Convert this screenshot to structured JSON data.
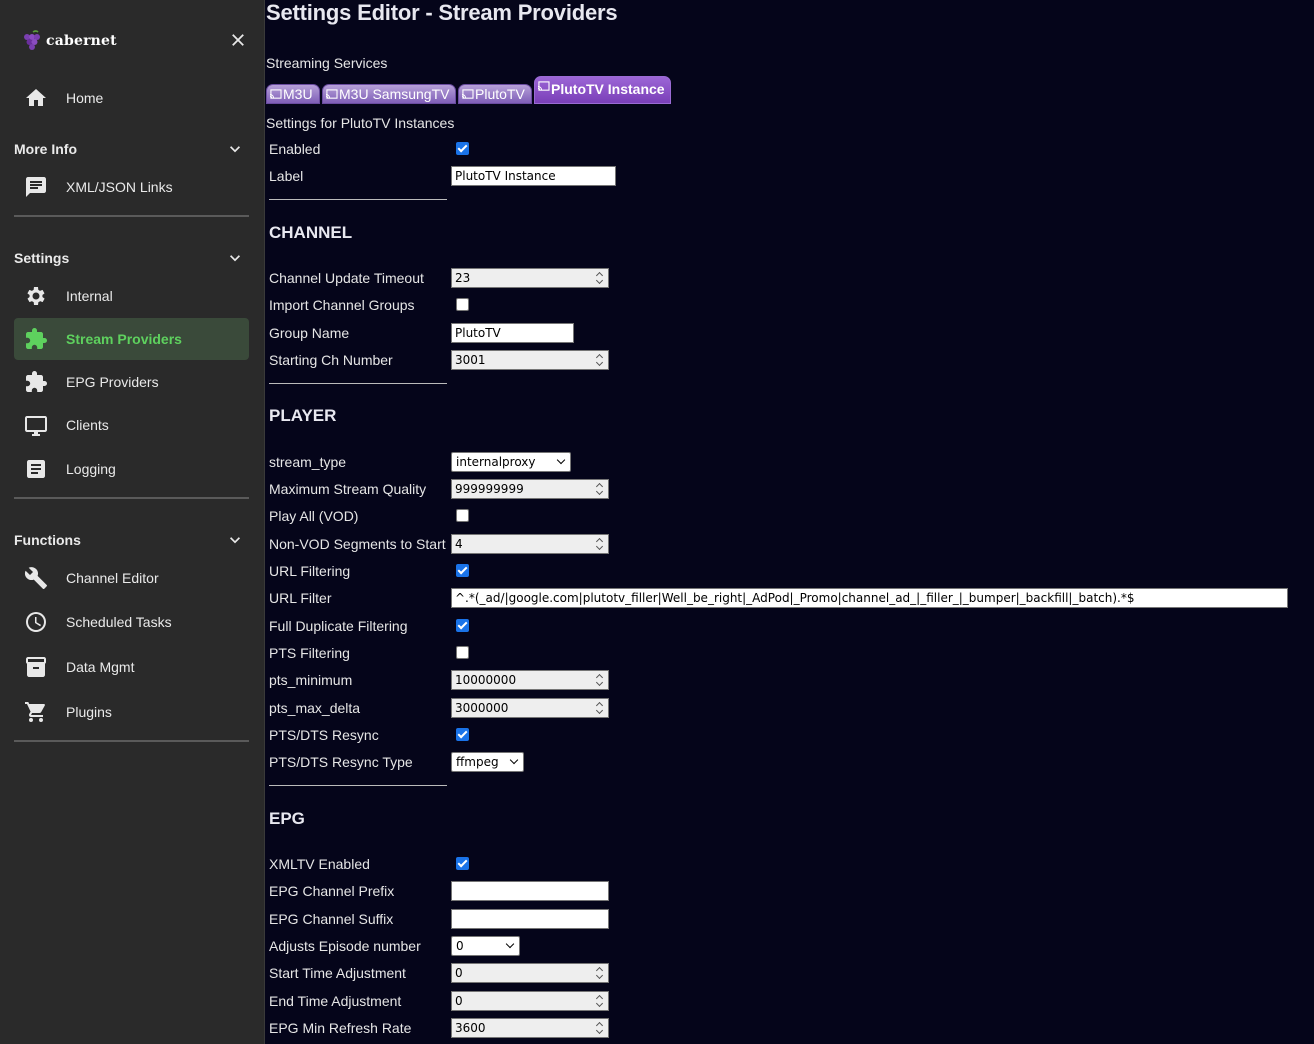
{
  "brand": {
    "name": "cabernet"
  },
  "sidebar": {
    "home": "Home",
    "more_info": {
      "title": "More Info",
      "items": [
        "XML/JSON Links"
      ]
    },
    "settings": {
      "title": "Settings",
      "items": [
        "Internal",
        "Stream Providers",
        "EPG Providers",
        "Clients",
        "Logging"
      ]
    },
    "functions": {
      "title": "Functions",
      "items": [
        "Channel Editor",
        "Scheduled Tasks",
        "Data Mgmt",
        "Plugins"
      ]
    },
    "active_item": "Stream Providers"
  },
  "main": {
    "title": "Settings Editor - Stream Providers",
    "services_label": "Streaming Services",
    "tabs": [
      "M3U",
      "M3U SamsungTV",
      "PlutoTV",
      "PlutoTV Instance"
    ],
    "active_tab": "PlutoTV Instance",
    "instances_label": "Settings for PlutoTV Instances",
    "general": {
      "enabled_label": "Enabled",
      "enabled": true,
      "label_label": "Label",
      "label_value": "PlutoTV Instance"
    },
    "channel": {
      "heading": "CHANNEL",
      "update_timeout_label": "Channel Update Timeout",
      "update_timeout": "23",
      "import_groups_label": "Import Channel Groups",
      "import_groups": false,
      "group_name_label": "Group Name",
      "group_name": "PlutoTV",
      "starting_ch_label": "Starting Ch Number",
      "starting_ch": "3001"
    },
    "player": {
      "heading": "PLAYER",
      "stream_type_label": "stream_type",
      "stream_type": "internalproxy",
      "max_quality_label": "Maximum Stream Quality",
      "max_quality": "999999999",
      "play_all_label": "Play All (VOD)",
      "play_all": false,
      "segments_label": "Non-VOD Segments to Start",
      "segments": "4",
      "url_filtering_label": "URL Filtering",
      "url_filtering": true,
      "url_filter_label": "URL Filter",
      "url_filter": "^.*(_ad/|google.com|plutotv_filler|Well_be_right|_AdPod|_Promo|channel_ad_|_filler_|_bumper|_backfill|_batch).*$",
      "dup_filtering_label": "Full Duplicate Filtering",
      "dup_filtering": true,
      "pts_filtering_label": "PTS Filtering",
      "pts_filtering": false,
      "pts_minimum_label": "pts_minimum",
      "pts_minimum": "10000000",
      "pts_max_delta_label": "pts_max_delta",
      "pts_max_delta": "3000000",
      "resync_label": "PTS/DTS Resync",
      "resync": true,
      "resync_type_label": "PTS/DTS Resync Type",
      "resync_type": "ffmpeg"
    },
    "epg": {
      "heading": "EPG",
      "xmltv_label": "XMLTV Enabled",
      "xmltv": true,
      "prefix_label": "EPG Channel Prefix",
      "prefix": "",
      "suffix_label": "EPG Channel Suffix",
      "suffix": "",
      "episode_label": "Adjusts Episode number",
      "episode": "0",
      "start_adj_label": "Start Time Adjustment",
      "start_adj": "0",
      "end_adj_label": "End Time Adjustment",
      "end_adj": "0",
      "refresh_label": "EPG Min Refresh Rate",
      "refresh": "3600"
    }
  }
}
